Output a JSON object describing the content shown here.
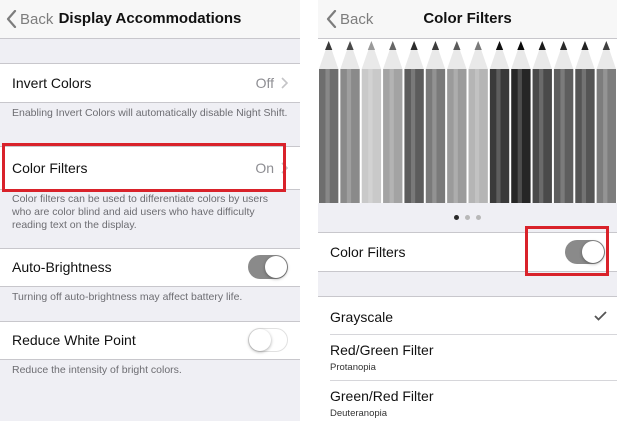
{
  "left": {
    "nav": {
      "back_label": "Back",
      "title": "Display Accommodations"
    },
    "invert": {
      "label": "Invert Colors",
      "value": "Off",
      "footer": "Enabling Invert Colors will automatically disable Night Shift."
    },
    "color_filters": {
      "label": "Color Filters",
      "value": "On",
      "footer": "Color filters can be used to differentiate colors by users who are color blind and aid users who have difficulty reading text on the display."
    },
    "auto_brightness": {
      "label": "Auto-Brightness",
      "state": "on",
      "footer": "Turning off auto-brightness may affect battery life."
    },
    "reduce_white": {
      "label": "Reduce White Point",
      "state": "off",
      "footer": "Reduce the intensity of bright colors."
    }
  },
  "right": {
    "nav": {
      "back_label": "Back",
      "title": "Color Filters"
    },
    "preview": {
      "page_count": 3,
      "active_page": 1
    },
    "toggle_row": {
      "label": "Color Filters",
      "state": "on"
    },
    "options": [
      {
        "label": "Grayscale",
        "sub": "",
        "selected": true
      },
      {
        "label": "Red/Green Filter",
        "sub": "Protanopia",
        "selected": false
      },
      {
        "label": "Green/Red Filter",
        "sub": "Deuteranopia",
        "selected": false
      }
    ]
  },
  "colors": {
    "highlight": "#d9222a",
    "toggle_on": "#8a8a8a",
    "secondary_text": "#8e8e93"
  },
  "icons": [
    "chevron-left-icon",
    "chevron-right-icon",
    "checkmark-icon"
  ]
}
